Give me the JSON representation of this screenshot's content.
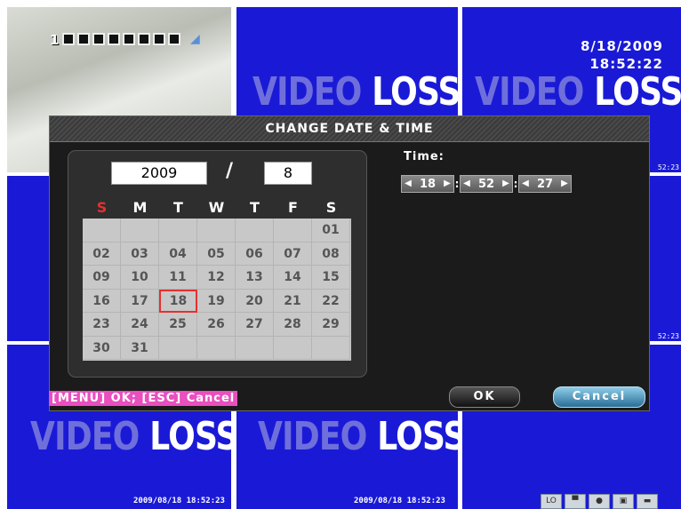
{
  "status": {
    "camera_number": "1",
    "hdd_progress": "0%",
    "date": "8/18/2009",
    "time": "18:52:22",
    "side_time": "52:23"
  },
  "tiles": {
    "video_loss_left": "VIDEO",
    "video_loss_right": "LOSS",
    "timestamp": "2009/08/18 18:52:23"
  },
  "dialog": {
    "title": "CHANGE DATE & TIME",
    "year": "2009",
    "separator": "/",
    "month": "8",
    "weekdays": [
      "S",
      "M",
      "T",
      "W",
      "T",
      "F",
      "S"
    ],
    "days": [
      "",
      "",
      "",
      "",
      "",
      "",
      "01",
      "02",
      "03",
      "04",
      "05",
      "06",
      "07",
      "08",
      "09",
      "10",
      "11",
      "12",
      "13",
      "14",
      "15",
      "16",
      "17",
      "18",
      "19",
      "20",
      "21",
      "22",
      "23",
      "24",
      "25",
      "26",
      "27",
      "28",
      "29",
      "30",
      "31",
      "",
      "",
      "",
      "",
      ""
    ],
    "selected_day": "18",
    "time_label": "Time:",
    "hour": "18",
    "minute": "52",
    "second": "27",
    "ok_label": "OK",
    "cancel_label": "Cancel"
  },
  "footer_hint": "[MENU] OK; [ESC] Cancel",
  "taskbar": [
    "LO",
    "",
    "",
    "",
    ""
  ],
  "colors": {
    "tile_blue": "#1a1ad6",
    "sunday_red": "#e53030",
    "hint_pink": "#e94fbf",
    "cancel_blue": "#2a6e96"
  }
}
